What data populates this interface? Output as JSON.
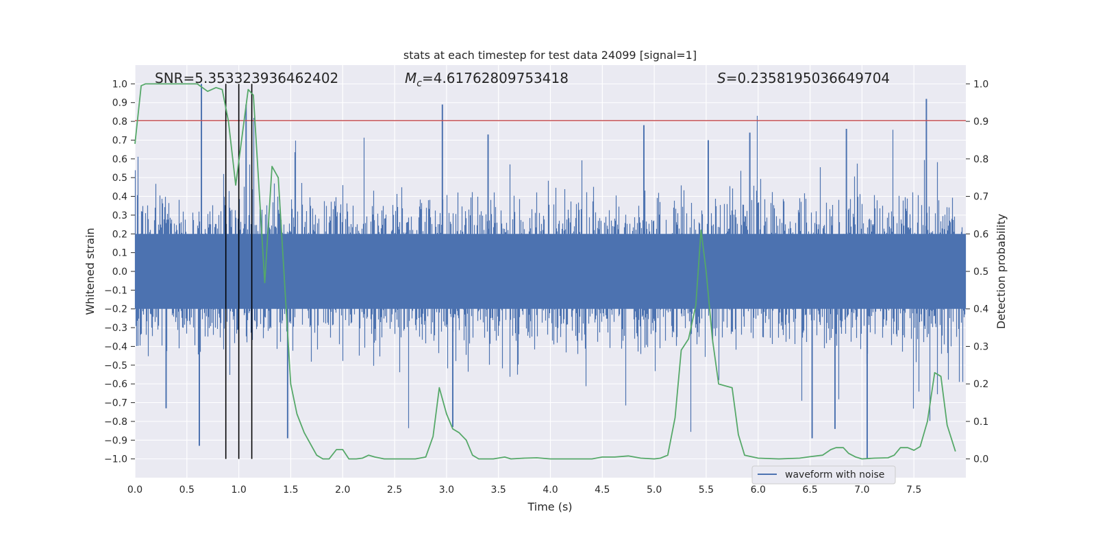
{
  "chart_data": {
    "type": "line",
    "title": "stats at each timestep for test data 24099 [signal=1]",
    "xlabel": "Time (s)",
    "ylabel": "Whitened strain",
    "ylabel_right": "Detection probability",
    "xlim": [
      0.0,
      8.0
    ],
    "ylim": [
      -1.1,
      1.1
    ],
    "ylim_right": [
      -0.05,
      1.05
    ],
    "grid": true,
    "xticks": [
      "0.0",
      "0.5",
      "1.0",
      "1.5",
      "2.0",
      "2.5",
      "3.0",
      "3.5",
      "4.0",
      "4.5",
      "5.0",
      "5.5",
      "6.0",
      "6.5",
      "7.0",
      "7.5"
    ],
    "yticks": [
      "1.0",
      "0.9",
      "0.8",
      "0.7",
      "0.6",
      "0.5",
      "0.4",
      "0.3",
      "0.2",
      "0.1",
      "0.0",
      "−0.1",
      "−0.2",
      "−0.3",
      "−0.4",
      "−0.5",
      "−0.6",
      "−0.7",
      "−0.8",
      "−0.9",
      "−1.0"
    ],
    "yticks_right": [
      "1.0",
      "0.9",
      "0.8",
      "0.7",
      "0.6",
      "0.5",
      "0.4",
      "0.3",
      "0.2",
      "0.1",
      "0.0"
    ],
    "annotations": {
      "snr": "SNR=5.353323936462402",
      "mc_symbol": "M",
      "mc_sub": "c",
      "mc_value": "=4.61762809753418",
      "s_symbol": "S",
      "s_value": "=0.2358195036649704"
    },
    "legend": {
      "placement": "lower-right",
      "entries": [
        "waveform with noise"
      ]
    },
    "threshold_line": {
      "y": 0.8,
      "color": "#C44E52"
    },
    "vertical_lines": {
      "x": [
        0.875,
        1.0,
        1.125
      ],
      "color": "#000000"
    },
    "colors": {
      "waveform": "#4C72B0",
      "probability": "#55A868",
      "axes_bg": "#EAEAF2",
      "grid": "#FFFFFF"
    },
    "waveform_notable_peaks": [
      {
        "x": 0.64,
        "y": 1.0
      },
      {
        "x": 0.62,
        "y": -0.93
      },
      {
        "x": 1.07,
        "y": 0.89
      },
      {
        "x": 0.3,
        "y": -0.73
      },
      {
        "x": 2.96,
        "y": 0.89
      },
      {
        "x": 3.06,
        "y": -0.83
      },
      {
        "x": 1.47,
        "y": -0.89
      },
      {
        "x": 4.9,
        "y": 0.78
      },
      {
        "x": 7.62,
        "y": 0.92
      },
      {
        "x": 7.05,
        "y": -1.0
      },
      {
        "x": 6.52,
        "y": -0.89
      },
      {
        "x": 6.74,
        "y": -0.84
      },
      {
        "x": 5.92,
        "y": 0.74
      },
      {
        "x": 5.52,
        "y": 0.7
      },
      {
        "x": 3.4,
        "y": 0.73
      },
      {
        "x": 6.85,
        "y": 0.76
      }
    ],
    "series": [
      {
        "name": "",
        "axis": "right",
        "color": "#55A868",
        "x": [
          0.0,
          0.06,
          0.1,
          0.6,
          0.7,
          0.78,
          0.84,
          0.9,
          0.97,
          1.09,
          1.14,
          1.25,
          1.32,
          1.38,
          1.5,
          1.56,
          1.63,
          1.75,
          1.81,
          1.87,
          1.94,
          2.0,
          2.06,
          2.13,
          2.19,
          2.25,
          2.31,
          2.4,
          2.5,
          2.6,
          2.7,
          2.8,
          2.87,
          2.93,
          3.0,
          3.06,
          3.12,
          3.19,
          3.25,
          3.31,
          3.45,
          3.56,
          3.62,
          3.75,
          3.87,
          4.0,
          4.2,
          4.4,
          4.5,
          4.62,
          4.75,
          4.87,
          5.0,
          5.06,
          5.13,
          5.2,
          5.26,
          5.33,
          5.4,
          5.45,
          5.5,
          5.56,
          5.62,
          5.68,
          5.75,
          5.81,
          5.87,
          6.0,
          6.2,
          6.4,
          6.5,
          6.62,
          6.7,
          6.75,
          6.82,
          6.87,
          6.94,
          7.0,
          7.12,
          7.25,
          7.31,
          7.37,
          7.44,
          7.5,
          7.56,
          7.63,
          7.7,
          7.76,
          7.82,
          7.9
        ],
        "y": [
          0.84,
          0.995,
          1.0,
          1.0,
          0.98,
          0.99,
          0.985,
          0.9,
          0.73,
          0.985,
          0.97,
          0.47,
          0.78,
          0.75,
          0.2,
          0.12,
          0.07,
          0.01,
          0.0,
          0.0,
          0.025,
          0.025,
          0.0,
          0.0,
          0.002,
          0.01,
          0.005,
          0.0,
          0.0,
          0.0,
          0.0,
          0.005,
          0.06,
          0.19,
          0.12,
          0.08,
          0.07,
          0.05,
          0.01,
          0.0,
          0.0,
          0.005,
          0.0,
          0.002,
          0.003,
          0.0,
          0.0,
          0.0,
          0.005,
          0.005,
          0.008,
          0.002,
          0.0,
          0.002,
          0.01,
          0.11,
          0.29,
          0.32,
          0.41,
          0.61,
          0.5,
          0.32,
          0.2,
          0.195,
          0.19,
          0.065,
          0.01,
          0.002,
          0.0,
          0.002,
          0.006,
          0.01,
          0.025,
          0.03,
          0.03,
          0.015,
          0.005,
          0.0,
          0.002,
          0.003,
          0.01,
          0.03,
          0.03,
          0.023,
          0.033,
          0.1,
          0.23,
          0.22,
          0.09,
          0.02
        ]
      }
    ]
  }
}
